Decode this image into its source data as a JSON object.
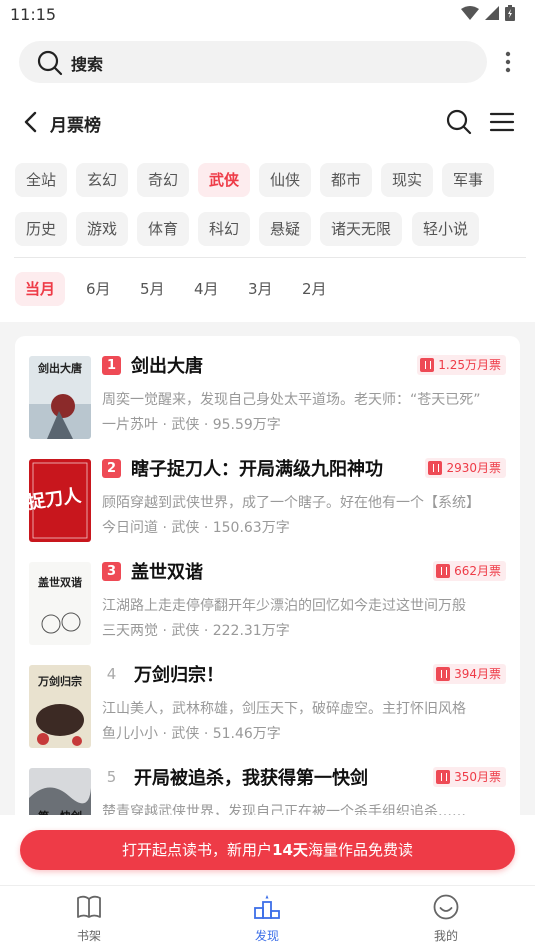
{
  "status_bar": {
    "time": "11:15"
  },
  "search": {
    "label": "搜索"
  },
  "header": {
    "title": "月票榜"
  },
  "categories": [
    {
      "label": "全站",
      "active": false
    },
    {
      "label": "玄幻",
      "active": false
    },
    {
      "label": "奇幻",
      "active": false
    },
    {
      "label": "武侠",
      "active": true
    },
    {
      "label": "仙侠",
      "active": false
    },
    {
      "label": "都市",
      "active": false
    },
    {
      "label": "现实",
      "active": false
    },
    {
      "label": "军事",
      "active": false
    },
    {
      "label": "历史",
      "active": false
    },
    {
      "label": "游戏",
      "active": false
    },
    {
      "label": "体育",
      "active": false
    },
    {
      "label": "科幻",
      "active": false
    },
    {
      "label": "悬疑",
      "active": false
    },
    {
      "label": "诸天无限",
      "active": false
    },
    {
      "label": "轻小说",
      "active": false
    }
  ],
  "months": [
    {
      "label": "当月",
      "active": true
    },
    {
      "label": "6月",
      "active": false
    },
    {
      "label": "5月",
      "active": false
    },
    {
      "label": "4月",
      "active": false
    },
    {
      "label": "3月",
      "active": false
    },
    {
      "label": "2月",
      "active": false
    }
  ],
  "books": [
    {
      "rank": "1",
      "title": "剑出大唐",
      "votes": "1.25万月票",
      "desc": "周奕一觉醒来，发现自己身处太平道场。老天师：“苍天已死”",
      "author": "一片苏叶",
      "genre": "武侠",
      "words": "95.59万字",
      "cover_text": "剑出大唐"
    },
    {
      "rank": "2",
      "title": "瞎子捉刀人：开局满级九阳神功",
      "votes": "2930月票",
      "desc": "顾陌穿越到武侠世界，成了一个瞎子。好在他有一个【系统】",
      "author": "今日问道",
      "genre": "武侠",
      "words": "150.63万字",
      "cover_text": "捉刀人"
    },
    {
      "rank": "3",
      "title": "盖世双谐",
      "votes": "662月票",
      "desc": "江湖路上走走停停翻开年少漂泊的回忆如今走过这世间万般",
      "author": "三天两觉",
      "genre": "武侠",
      "words": "222.31万字",
      "cover_text": "盖世双谐"
    },
    {
      "rank": "4",
      "title": "万剑归宗！",
      "votes": "394月票",
      "desc": "江山美人，武林称雄，剑压天下，破碎虚空。主打怀旧风格",
      "author": "鱼儿小小",
      "genre": "武侠",
      "words": "51.46万字",
      "cover_text": "万剑归宗"
    },
    {
      "rank": "5",
      "title": "开局被追杀，我获得第一快剑",
      "votes": "350月票",
      "desc": "楚青穿越武侠世界，发现自己正在被一个杀手组织追杀……",
      "author": "",
      "genre": "",
      "words": "",
      "cover_text": "第一快剑"
    }
  ],
  "meta_separator": "·",
  "cta": {
    "prefix": "打开起点读书，新用户",
    "highlight": "14天",
    "suffix": "海量作品免费读"
  },
  "tabbar": [
    {
      "label": "书架",
      "icon": "book-icon",
      "active": false
    },
    {
      "label": "发现",
      "icon": "discover-icon",
      "active": true
    },
    {
      "label": "我的",
      "icon": "smile-icon",
      "active": false
    }
  ],
  "colors": {
    "accent": "#ee3b47",
    "accent_bg": "#fdecee",
    "tab_active": "#3d6fe8"
  }
}
